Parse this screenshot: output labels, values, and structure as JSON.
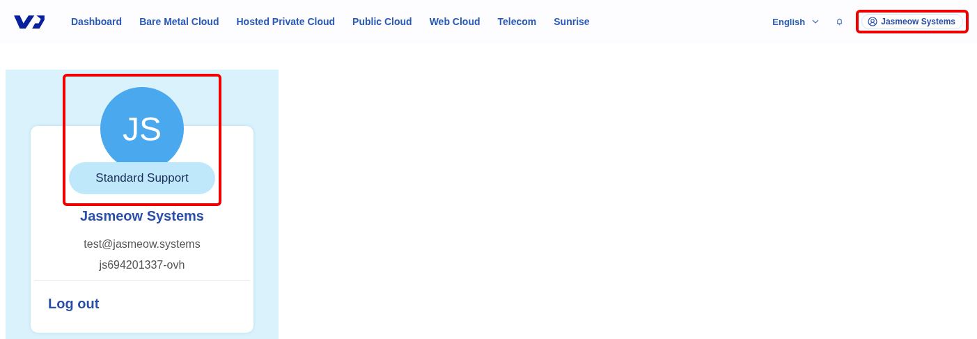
{
  "nav": {
    "items": [
      "Dashboard",
      "Bare Metal Cloud",
      "Hosted Private Cloud",
      "Public Cloud",
      "Web Cloud",
      "Telecom",
      "Sunrise"
    ],
    "language": "English",
    "account": {
      "label": "Jasmeow Systems",
      "highlighted": true
    }
  },
  "profile": {
    "initials": "JS",
    "support_level": "Standard Support",
    "highlighted": true,
    "name": "Jasmeow Systems",
    "email": "test@jasmeow.systems",
    "nic": "js694201337-ovh",
    "logout": "Log out"
  }
}
